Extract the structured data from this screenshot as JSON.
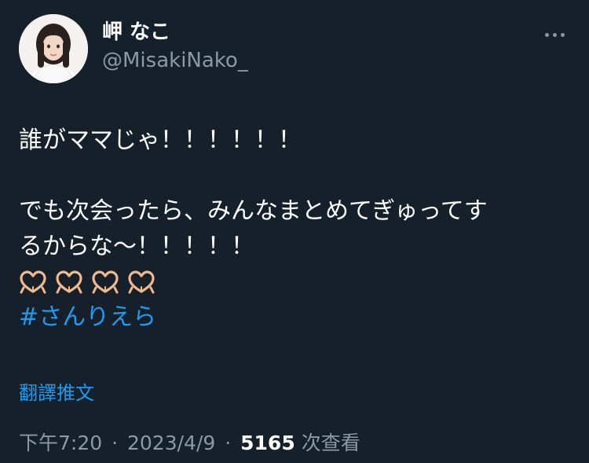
{
  "author": {
    "display_name": "岬 なこ",
    "handle": "@MisakiNako_"
  },
  "tweet": {
    "line1": "誰がママじゃ！！！！！！",
    "line2": "でも次会ったら、みんなまとめてぎゅってす",
    "line3": "るからな〜！！！！！",
    "emoji": [
      "heart-hands",
      "heart-hands",
      "heart-hands",
      "heart-hands"
    ],
    "hashtag": "#さんりえら"
  },
  "translate_label": "翻譯推文",
  "meta": {
    "time": "下午7:20",
    "separator": "·",
    "date": "2023/4/9",
    "views_count": "5165",
    "views_label": "次查看"
  },
  "colors": {
    "background": "#15202b",
    "text": "#ffffff",
    "secondary": "#8b98a5",
    "link": "#1d9bf0"
  }
}
